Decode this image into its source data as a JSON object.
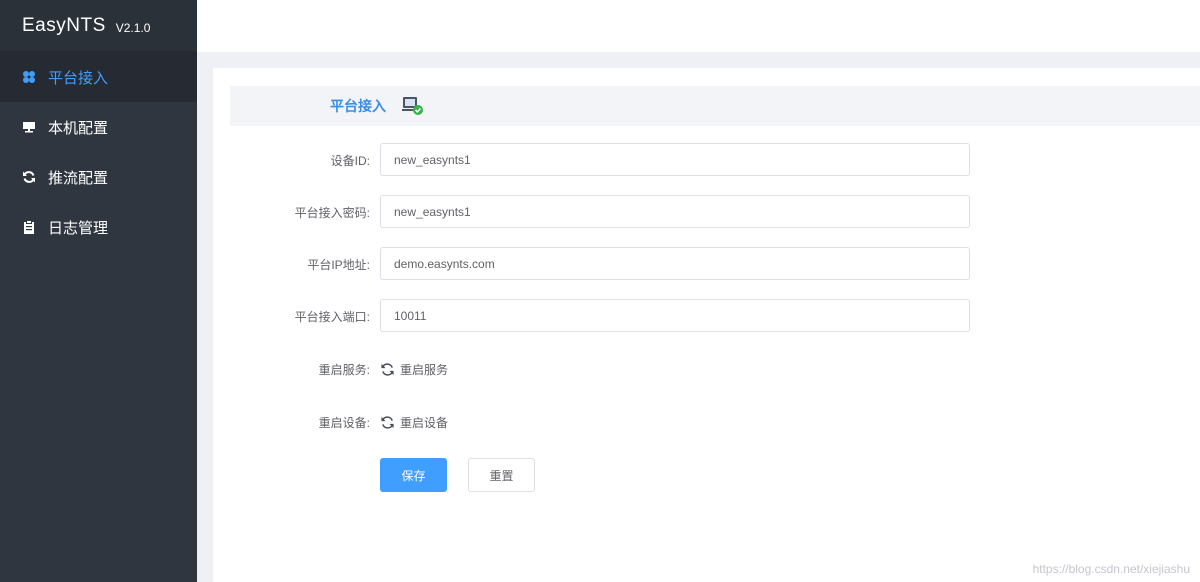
{
  "brand": {
    "name": "EasyNTS",
    "version": "V2.1.0"
  },
  "sidebar": {
    "items": [
      {
        "label": "平台接入",
        "icon": "grid-dots-icon",
        "active": true
      },
      {
        "label": "本机配置",
        "icon": "monitor-icon",
        "active": false
      },
      {
        "label": "推流配置",
        "icon": "refresh-icon",
        "active": false
      },
      {
        "label": "日志管理",
        "icon": "clipboard-icon",
        "active": false
      }
    ]
  },
  "section": {
    "title": "平台接入",
    "status_icon": "device-connected-icon"
  },
  "form": {
    "device_id": {
      "label": "设备ID:",
      "value": "new_easynts1"
    },
    "password": {
      "label": "平台接入密码:",
      "value": "new_easynts1"
    },
    "ip": {
      "label": "平台IP地址:",
      "value": "demo.easynts.com"
    },
    "port": {
      "label": "平台接入端口:",
      "value": "10011"
    },
    "restart_service": {
      "label": "重启服务:",
      "action": "重启服务"
    },
    "restart_device": {
      "label": "重启设备:",
      "action": "重启设备"
    }
  },
  "buttons": {
    "save": "保存",
    "reset": "重置"
  },
  "watermark": "https://blog.csdn.net/xiejiashu",
  "colors": {
    "sidebar_bg": "#2f3640",
    "accent": "#409eff",
    "page_bg": "#eef0f6"
  }
}
